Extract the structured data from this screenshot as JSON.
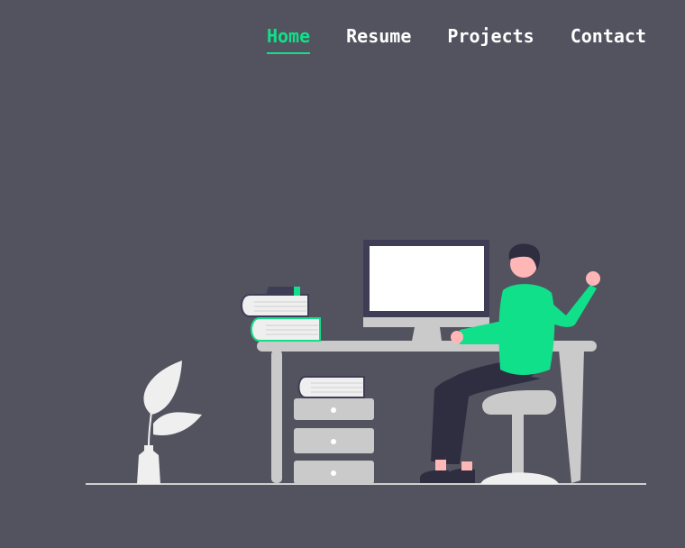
{
  "nav": {
    "items": [
      {
        "label": "Home",
        "active": true
      },
      {
        "label": "Resume",
        "active": false
      },
      {
        "label": "Projects",
        "active": false
      },
      {
        "label": "Contact",
        "active": false
      }
    ]
  },
  "hero": {
    "illustration": "person-working-at-desk-illustration"
  },
  "colors": {
    "background": "#53535f",
    "accent": "#10e08a",
    "nav_text": "#ffffff",
    "furniture": "#cacaca",
    "pants": "#2f2e41",
    "skin": "#ffb6b6"
  }
}
